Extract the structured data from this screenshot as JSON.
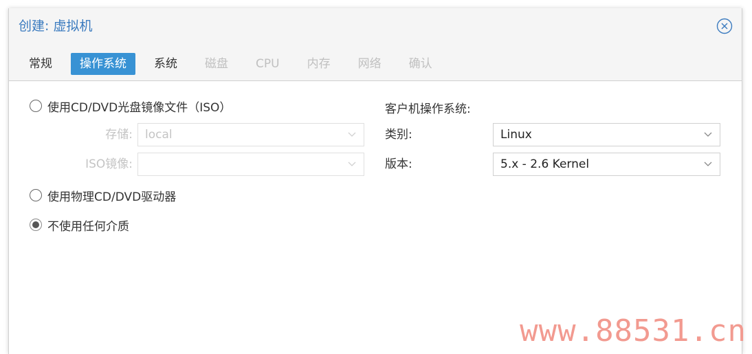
{
  "window": {
    "title": "创建: 虚拟机"
  },
  "tabs": [
    {
      "label": "常规",
      "state": "normal"
    },
    {
      "label": "操作系统",
      "state": "active"
    },
    {
      "label": "系统",
      "state": "normal"
    },
    {
      "label": "磁盘",
      "state": "disabled"
    },
    {
      "label": "CPU",
      "state": "disabled"
    },
    {
      "label": "内存",
      "state": "disabled"
    },
    {
      "label": "网络",
      "state": "disabled"
    },
    {
      "label": "确认",
      "state": "disabled"
    }
  ],
  "media": {
    "iso_option_label": "使用CD/DVD光盘镜像文件（ISO）",
    "storage_label": "存储:",
    "storage_value": "local",
    "iso_image_label": "ISO镜像:",
    "iso_image_value": "",
    "physical_option_label": "使用物理CD/DVD驱动器",
    "none_option_label": "不使用任何介质",
    "selected": "none"
  },
  "guest_os": {
    "heading": "客户机操作系统:",
    "type_label": "类别:",
    "type_value": "Linux",
    "version_label": "版本:",
    "version_value": "5.x - 2.6 Kernel"
  },
  "icons": {
    "close": "close-circle-icon",
    "dropdown": "chevron-down-icon"
  },
  "colors": {
    "title": "#3b7bbf",
    "active_tab": "#3892d4",
    "disabled_text": "#c4c4c4",
    "watermark": "#f29a90"
  },
  "watermark": "www.88531.cn"
}
